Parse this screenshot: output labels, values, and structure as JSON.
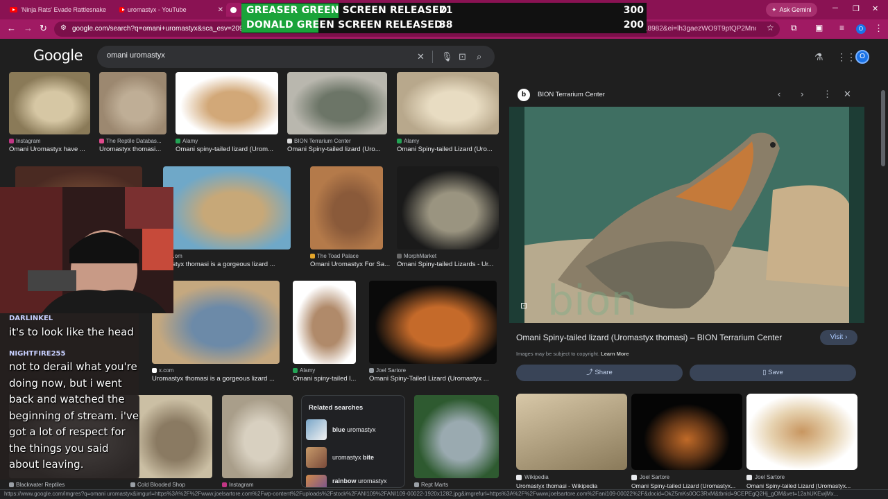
{
  "browser": {
    "tabs": [
      {
        "title": "'Ninja Rats' Evade Rattlesnake"
      },
      {
        "title": "uromastyx - YouTube"
      },
      {
        "title": ""
      }
    ],
    "ask_gemini": "Ask Gemini",
    "url": "google.com/search?q=omani+uromastyx&sca_esv=20900b",
    "url_tail": "18982&ei=lh3gaezWO9T9ptQP2Mnc...",
    "profile_initial": "O"
  },
  "overlay": {
    "rows": [
      {
        "label": "GREASER GREEN SCREEN RELEASED",
        "count": "71",
        "cost": "300",
        "progress": 0.24
      },
      {
        "label": "DONALD GREEN SCREEN RELEASED",
        "count": "38",
        "cost": "200",
        "progress": 0.19
      }
    ]
  },
  "header": {
    "logo": "Google",
    "query": "omani uromastyx",
    "avatar": "O"
  },
  "results": [
    {
      "source": "Instagram",
      "caption": "Omani Uromastyx have ...",
      "fav": "#c13584",
      "c1": "#8a7a58",
      "c2": "#d6c7a4"
    },
    {
      "source": "The Reptile Databas...",
      "caption": "Uromastyx thomasi...",
      "fav": "#e04a8c",
      "c1": "#9c8870",
      "c2": "#bfae96"
    },
    {
      "source": "Alamy",
      "caption": "Omani spiny-tailed lizard (Urom...",
      "fav": "#23a455",
      "c1": "#ffffff",
      "c2": "#d2a878"
    },
    {
      "source": "BION Terrarium Center",
      "caption": "Omani Spiny-tailed lizard (Uro...",
      "fav": "#dddddd",
      "c1": "#b9b7ae",
      "c2": "#6c7567"
    },
    {
      "source": "Alamy",
      "caption": "Omani Spiny-tailed Lizard (Uro...",
      "fav": "#23a455",
      "c1": "#b8a88c",
      "c2": "#e8dcc2"
    },
    {
      "source": "",
      "caption": "",
      "fav": "#000",
      "c1": "#4a2a22",
      "c2": "#6e4632"
    },
    {
      "source": "...om",
      "caption": "...astyx thomasi is a gorgeous lizard ...",
      "fav": "#9aa0a6",
      "c1": "#6fa8c8",
      "c2": "#c7a878"
    },
    {
      "source": "The Toad Palace",
      "caption": "Omani Uromastyx For Sa...",
      "fav": "#e3a52a",
      "c1": "#b47a4a",
      "c2": "#8a5a3a"
    },
    {
      "source": "MorphMarket",
      "caption": "Omani Spiny-tailed Lizards - Ur...",
      "fav": "#6a6a6a",
      "c1": "#1a1a1a",
      "c2": "#9a9480"
    },
    {
      "source": "x.com",
      "caption": "Uromastyx thomasi is a gorgeous lizard ...",
      "fav": "#ffffff",
      "c1": "#c5a87f",
      "c2": "#6c8aa8"
    },
    {
      "source": "Alamy",
      "caption": "Omani spiny-tailed l...",
      "fav": "#23a455",
      "c1": "#ffffff",
      "c2": "#b08a6a"
    },
    {
      "source": "Joel Sartore",
      "caption": "Omani Spiny-Tailed Lizard (Uromastyx ...",
      "fav": "#9aa0a6",
      "c1": "#0a0a0a",
      "c2": "#c56a2a"
    },
    {
      "source": "Blackwater Reptiles",
      "caption": "",
      "fav": "#9aa0a6",
      "c1": "#333",
      "c2": "#555"
    },
    {
      "source": "Cold Blooded Shop",
      "caption": "",
      "fav": "#9aa0a6",
      "c1": "#cbbfa4",
      "c2": "#8a7a62"
    },
    {
      "source": "Instagram",
      "caption": "",
      "fav": "#c13584",
      "c1": "#a99e8a",
      "c2": "#d8d0c0"
    },
    {
      "source": "Rept Marts",
      "caption": "",
      "fav": "#9aa0a6",
      "c1": "#2e5a30",
      "c2": "#9aaab0"
    }
  ],
  "related": {
    "title": "Related searches",
    "items": [
      {
        "bold": "blue",
        "rest": " uromastyx"
      },
      {
        "bold": "",
        "rest": "uromastyx ",
        "bold2": "bite"
      },
      {
        "bold": "rainbow",
        "rest": " uromastyx"
      }
    ]
  },
  "panel": {
    "logo": "b",
    "site": "BION Terrarium Center",
    "title": "Omani Spiny-tailed lizard (Uromastyx thomasi) – BION Terrarium Center",
    "visit": "Visit",
    "copyright": "Images may be subject to copyright.",
    "learn_more": "Learn More",
    "share": "Share",
    "save": "Save",
    "similar": [
      {
        "source": "Wikipedia",
        "caption": "Uromastyx thomasi - Wikipedia"
      },
      {
        "source": "Joel Sartore",
        "caption": "Omani Spiny-tailed Lizard (Uromastyx..."
      },
      {
        "source": "Joel Sartore",
        "caption": "Omani Spiny-tailed Lizard (Uromastyx..."
      }
    ]
  },
  "chat": {
    "messages": [
      {
        "user": "DARLINKEL",
        "text": "it's to look like the head"
      },
      {
        "user": "NIGHTFIRE255",
        "text": "not to derail what you're doing now, but i went back and watched the beginning of stream. i've got a lot of respect for the things you said about leaving."
      }
    ]
  },
  "status": {
    "url": "https://www.google.com/imgres?q=omani uromastyx&imgurl=https%3A%2F%2Fwww.joelsartore.com%2Fwp-content%2Fuploads%2Fstock%2FANI109%2FANI109-00022-1920x1282.jpg&imgrefurl=https%3A%2F%2Fwww.joelsartore.com%2Fani109-00022%2F&docid=OkZ5mKs0OC3RxM&tbnid=9CEPEgQ2Hj_gOM&vet=12ahUKEwjMx..."
  }
}
